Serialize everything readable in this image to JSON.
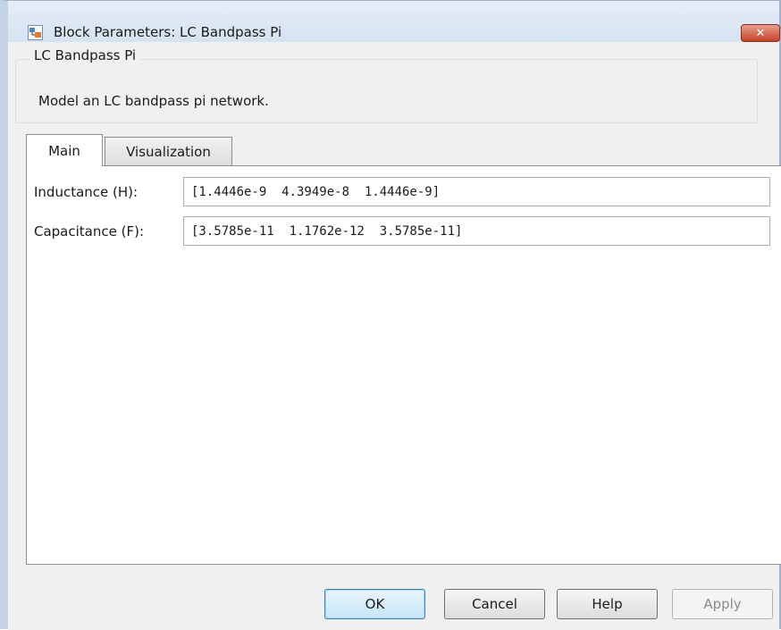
{
  "window": {
    "title": "Block Parameters: LC Bandpass Pi",
    "close_label": "✕"
  },
  "block": {
    "name": "LC Bandpass Pi",
    "description": "Model an LC bandpass pi network."
  },
  "tabs": [
    {
      "label": "Main",
      "selected": true
    },
    {
      "label": "Visualization",
      "selected": false
    }
  ],
  "parameters": {
    "inductance": {
      "label": "Inductance (H):",
      "value": "[1.4446e-9  4.3949e-8  1.4446e-9]"
    },
    "capacitance": {
      "label": "Capacitance (F):",
      "value": "[3.5785e-11  1.1762e-12  3.5785e-11]"
    }
  },
  "buttons": {
    "ok": "OK",
    "cancel": "Cancel",
    "help": "Help",
    "apply": "Apply"
  },
  "colors": {
    "title_bar": "#d5e2f1",
    "close_button": "#c7412a",
    "default_button": "#c5e4f8"
  }
}
